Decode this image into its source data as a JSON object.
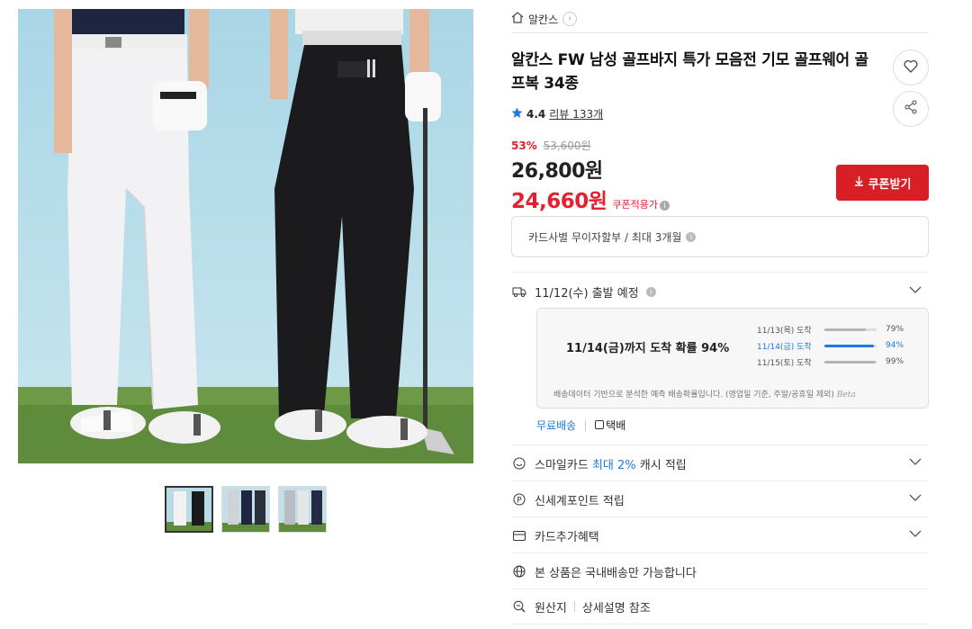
{
  "gallery": {
    "thumbnail_count": 3
  },
  "brand": {
    "name": "알칸스",
    "arrow": "›"
  },
  "product": {
    "title": "알칸스 FW 남성 골프바지 특가 모음전 기모 골프웨어 골프복 34종",
    "rating": "4.4",
    "review_label": "리뷰",
    "review_count": "133개"
  },
  "price": {
    "discount_rate": "53%",
    "original": "53,600원",
    "sale": "26,800원",
    "coupon_price": "24,660원",
    "coupon_note": "쿠폰적용가",
    "coupon_button": "쿠폰받기"
  },
  "installment": {
    "text": "카드사별 무이자할부 / 최대 3개월"
  },
  "shipping": {
    "dispatch": "11/12(수) 출발 예정",
    "main": "11/14(금)까지 도착 확률 94%",
    "probabilities": [
      {
        "date": "11/13(목) 도착",
        "pct": "79%",
        "value": 79,
        "active": false
      },
      {
        "date": "11/14(금) 도착",
        "pct": "94%",
        "value": 94,
        "active": true
      },
      {
        "date": "11/15(토) 도착",
        "pct": "99%",
        "value": 99,
        "active": false
      }
    ],
    "note": "배송데이터 기반으로 분석한 예측 배송확률입니다. (영업일 기준, 주말/공휴일 제외)",
    "beta": "Beta",
    "free": "무료배송",
    "method": "택배"
  },
  "benefits": {
    "smile_prefix": "스마일카드",
    "smile_highlight": "최대 2%",
    "smile_suffix": "캐시 적립",
    "shinsegae": "신세계포인트 적립",
    "card_extra": "카드추가혜택",
    "domestic": "본 상품은 국내배송만 가능합니다",
    "origin_label": "원산지",
    "origin_value": "상세설명 참조"
  },
  "colors": {
    "accent_red": "#e5212d",
    "button_red": "#d81f26",
    "accent_blue": "#1e78e0"
  }
}
